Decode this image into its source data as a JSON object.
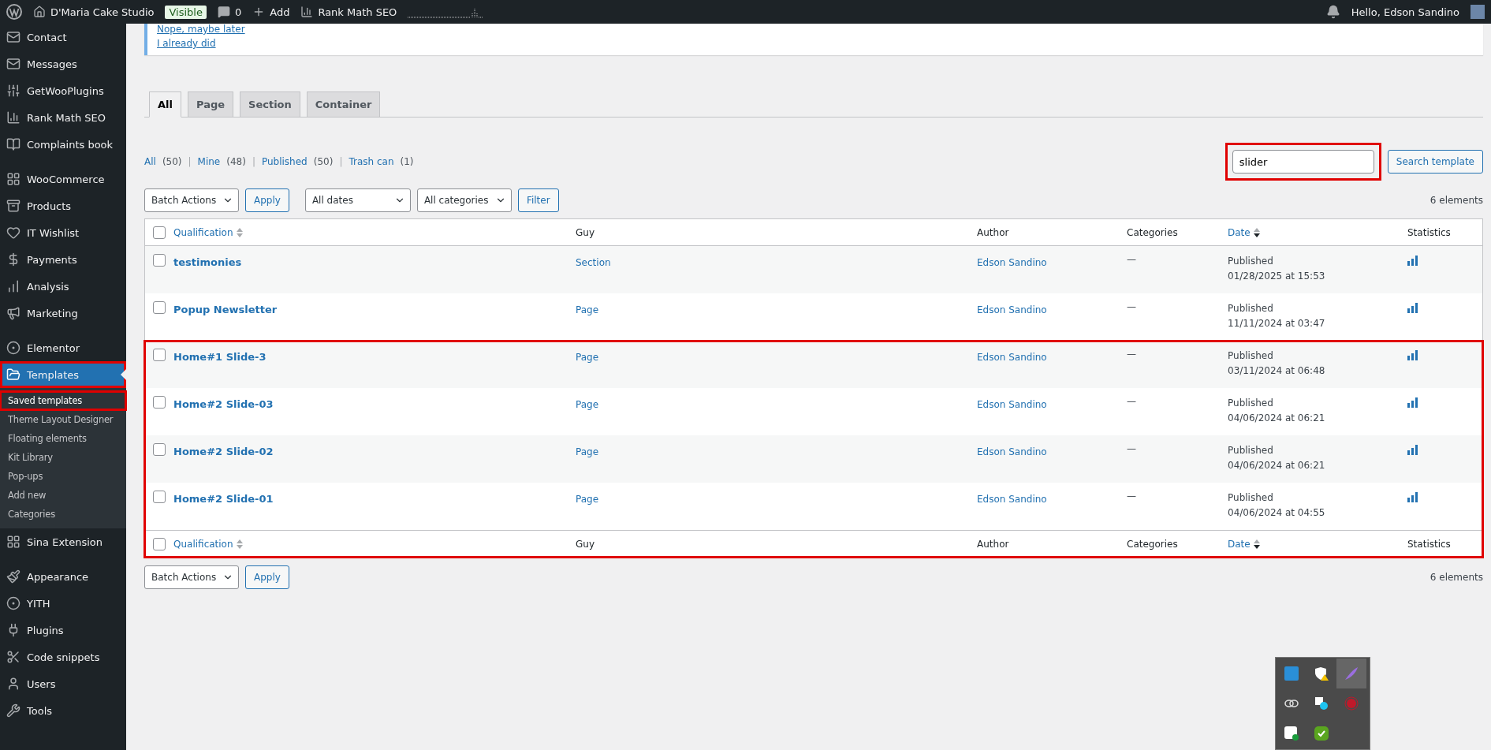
{
  "admin_bar": {
    "site": "D'Maria Cake Studio",
    "visibility_badge": "Visible",
    "comments": "0",
    "add": "Add",
    "seo": "Rank Math SEO",
    "greeting": "Hello, Edson Sandino"
  },
  "sidebar": {
    "groups": [
      {
        "items": [
          {
            "label": "Contact",
            "selected": false,
            "highlighted": false
          },
          {
            "label": "Messages",
            "selected": false,
            "highlighted": false
          },
          {
            "label": "GetWooPlugins",
            "selected": false,
            "highlighted": false
          },
          {
            "label": "Rank Math SEO",
            "selected": false,
            "highlighted": false
          },
          {
            "label": "Complaints book",
            "selected": false,
            "highlighted": false
          }
        ]
      },
      {
        "items": [
          {
            "label": "WooCommerce",
            "selected": false,
            "highlighted": false
          },
          {
            "label": "Products",
            "selected": false,
            "highlighted": false
          },
          {
            "label": "IT Wishlist",
            "selected": false,
            "highlighted": false
          },
          {
            "label": "Payments",
            "selected": false,
            "highlighted": false
          },
          {
            "label": "Analysis",
            "selected": false,
            "highlighted": false
          },
          {
            "label": "Marketing",
            "selected": false,
            "highlighted": false
          }
        ]
      },
      {
        "items": [
          {
            "label": "Elementor",
            "selected": false,
            "highlighted": false
          },
          {
            "label": "Templates",
            "selected": true,
            "highlighted": true,
            "children": [
              {
                "label": "Saved templates",
                "selected": true,
                "highlighted": true
              },
              {
                "label": "Theme Layout Designer",
                "selected": false,
                "highlighted": false
              },
              {
                "label": "Floating elements",
                "selected": false,
                "highlighted": false
              },
              {
                "label": "Kit Library",
                "selected": false,
                "highlighted": false
              },
              {
                "label": "Pop-ups",
                "selected": false,
                "highlighted": false
              },
              {
                "label": "Add new",
                "selected": false,
                "highlighted": false
              },
              {
                "label": "Categories",
                "selected": false,
                "highlighted": false
              }
            ]
          },
          {
            "label": "Sina Extension",
            "selected": false,
            "highlighted": false
          }
        ]
      },
      {
        "items": [
          {
            "label": "Appearance",
            "selected": false,
            "highlighted": false
          },
          {
            "label": "YITH",
            "selected": false,
            "highlighted": false
          },
          {
            "label": "Plugins",
            "selected": false,
            "highlighted": false
          },
          {
            "label": "Code snippets",
            "selected": false,
            "highlighted": false
          },
          {
            "label": "Users",
            "selected": false,
            "highlighted": false
          },
          {
            "label": "Tools",
            "selected": false,
            "highlighted": false
          }
        ]
      }
    ]
  },
  "notice": {
    "links": [
      "Nope, maybe later",
      "I already did"
    ]
  },
  "tabs": [
    {
      "label": "All",
      "selected": true
    },
    {
      "label": "Page",
      "selected": false
    },
    {
      "label": "Section",
      "selected": false
    },
    {
      "label": "Container",
      "selected": false
    }
  ],
  "views": [
    {
      "label": "All",
      "count": "(50)",
      "selected": false
    },
    {
      "separator": "|",
      "label": "Mine",
      "count": "(48)",
      "selected": false
    },
    {
      "separator": "|",
      "label": "Published",
      "count": "(50)",
      "selected": false
    },
    {
      "separator": "|",
      "label": "Trash can",
      "count": "(1)",
      "selected": false
    }
  ],
  "search": {
    "value": "slider",
    "button": "Search template",
    "highlighted": true
  },
  "filters": {
    "bulk": "Batch Actions",
    "apply": "Apply",
    "dates": "All dates",
    "categories": "All categories",
    "filter": "Filter"
  },
  "count": "6 elements",
  "table": {
    "select_all_checked": false,
    "columns": [
      {
        "label": "Qualification",
        "sortable": true,
        "sorted": false
      },
      {
        "label": "Guy",
        "sortable": false
      },
      {
        "label": "Author",
        "sortable": false
      },
      {
        "label": "Categories",
        "sortable": false
      },
      {
        "label": "Date",
        "sortable": true,
        "sorted": true
      },
      {
        "label": "Statistics",
        "sortable": false
      }
    ],
    "footer_columns": [
      {
        "label": "Qualification",
        "sortable": true
      },
      {
        "label": "Guy",
        "sortable": false
      },
      {
        "label": "Author",
        "sortable": false
      },
      {
        "label": "Categories",
        "sortable": false
      },
      {
        "label": "Date",
        "sortable": true
      },
      {
        "label": "Statistics",
        "sortable": false
      }
    ],
    "footer_select_all_checked": false,
    "rows": [
      {
        "title": "testimonies",
        "type": "Section",
        "author": "Edson Sandino",
        "categories": "—",
        "status": "Published",
        "date": "01/28/2025 at 15:53",
        "checked": false,
        "highlighted": false
      },
      {
        "title": "Popup Newsletter",
        "type": "Page",
        "author": "Edson Sandino",
        "categories": "—",
        "status": "Published",
        "date": "11/11/2024 at 03:47",
        "checked": false,
        "highlighted": false
      },
      {
        "title": "Home#1 Slide-3",
        "type": "Page",
        "author": "Edson Sandino",
        "categories": "—",
        "status": "Published",
        "date": "03/11/2024 at 06:48",
        "checked": false,
        "highlighted": true
      },
      {
        "title": "Home#2 Slide-03",
        "type": "Page",
        "author": "Edson Sandino",
        "categories": "—",
        "status": "Published",
        "date": "04/06/2024 at 06:21",
        "checked": false,
        "highlighted": true
      },
      {
        "title": "Home#2 Slide-02",
        "type": "Page",
        "author": "Edson Sandino",
        "categories": "—",
        "status": "Published",
        "date": "04/06/2024 at 06:21",
        "checked": false,
        "highlighted": true
      },
      {
        "title": "Home#2 Slide-01",
        "type": "Page",
        "author": "Edson Sandino",
        "categories": "—",
        "status": "Published",
        "date": "04/06/2024 at 04:55",
        "checked": false,
        "highlighted": true
      }
    ],
    "footer_highlighted": true
  },
  "bottom": {
    "bulk": "Batch Actions",
    "apply": "Apply",
    "count": "6 elements"
  }
}
